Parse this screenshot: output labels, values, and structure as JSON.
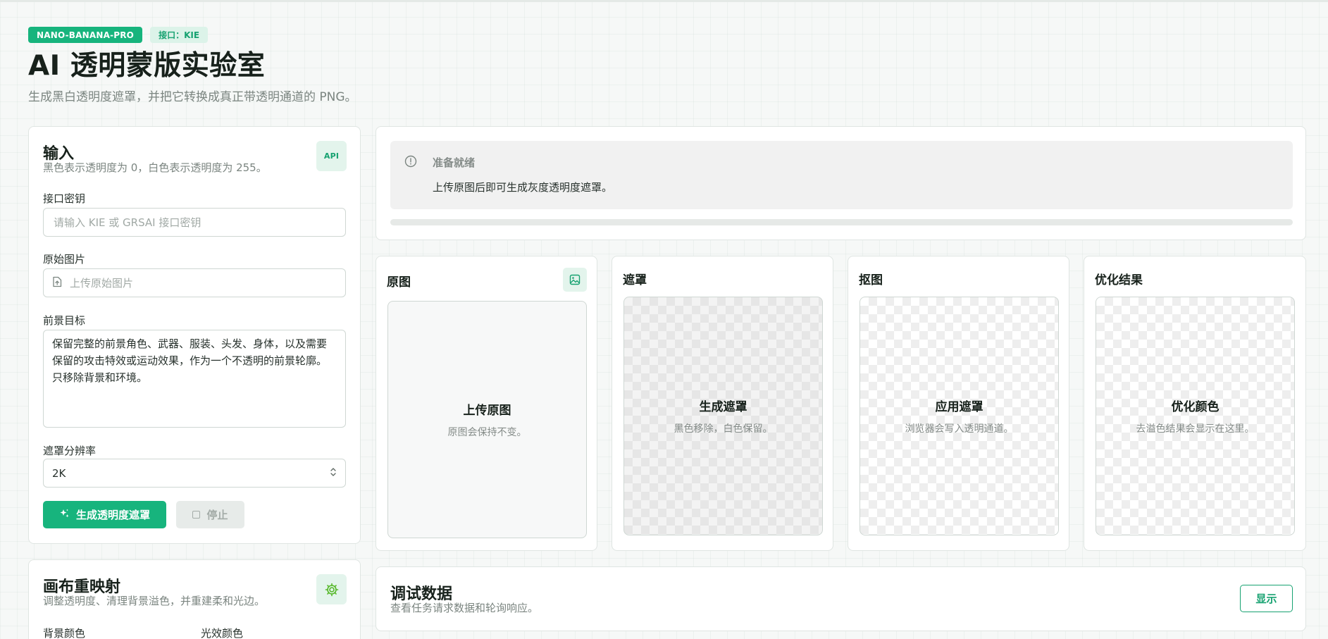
{
  "header": {
    "badge_model": "NANO-BANANA-PRO",
    "badge_api": "接口：KIE",
    "title": "AI 透明蒙版实验室",
    "subtitle": "生成黑白透明度遮罩，并把它转换成真正带透明通道的 PNG。"
  },
  "input_panel": {
    "title": "输入",
    "description": "黑色表示透明度为 0，白色表示透明度为 255。",
    "api_badge_icon": "API",
    "api_key_label": "接口密钥",
    "api_key_placeholder": "请输入 KIE 或 GRSAI 接口密钥",
    "source_image_label": "原始图片",
    "source_image_placeholder": "上传原始图片",
    "foreground_label": "前景目标",
    "foreground_value": "保留完整的前景角色、武器、服装、头发、身体，以及需要保留的攻击特效或运动效果，作为一个不透明的前景轮廓。只移除背景和环境。",
    "resolution_label": "遮罩分辨率",
    "resolution_value": "2K",
    "generate_button": "生成透明度遮罩",
    "stop_button": "停止"
  },
  "canvas_panel": {
    "title": "画布重映射",
    "description": "调整透明度、清理背景溢色，并重建柔和光边。",
    "background_color_label": "背景颜色",
    "glow_color_label": "光效颜色"
  },
  "status": {
    "title": "准备就绪",
    "message": "上传原图后即可生成灰度透明度遮罩。",
    "progress": 0
  },
  "panels": {
    "original": {
      "title": "原图",
      "zone_title": "上传原图",
      "zone_desc": "原图会保持不变。"
    },
    "mask": {
      "title": "遮罩",
      "zone_title": "生成遮罩",
      "zone_desc": "黑色移除，白色保留。"
    },
    "cutout": {
      "title": "抠图",
      "zone_title": "应用遮罩",
      "zone_desc": "浏览器会写入透明通道。"
    },
    "refined": {
      "title": "优化结果",
      "zone_title": "优化颜色",
      "zone_desc": "去溢色结果会显示在这里。"
    }
  },
  "debug": {
    "title": "调试数据",
    "description": "查看任务请求数据和轮询响应。",
    "show_button": "显示"
  },
  "colors": {
    "accent": "#17b47d",
    "accent_light": "#dcf3e9",
    "accent_text": "#17a271"
  },
  "icons": {
    "api": "api-badge-icon",
    "file_upload": "file-upload-icon",
    "sparkle": "sparkle-icon",
    "stop": "stop-square-icon",
    "settings": "gear-icon",
    "info": "info-circle-icon",
    "image": "image-icon",
    "select_arrows": "chevron-up-down-icon"
  }
}
